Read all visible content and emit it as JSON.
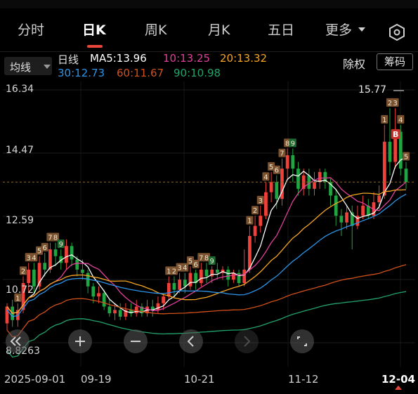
{
  "tabs": [
    {
      "label": "分时"
    },
    {
      "label": "日K"
    },
    {
      "label": "周K"
    },
    {
      "label": "月K"
    },
    {
      "label": "五日"
    },
    {
      "label": "更多"
    }
  ],
  "ma_select": {
    "label": "均线"
  },
  "ma_line1": {
    "period": "日线",
    "ma5": "MA5:13.96",
    "ma10": "10:13.25",
    "ma20": "20:13.32"
  },
  "ma_line2": {
    "ma30": "30:12.73",
    "ma60": "60:11.67",
    "ma90": "90:10.98"
  },
  "buttons": {
    "fuquan": "除权",
    "chouma": "筹码"
  },
  "y_axis": {
    "labels": [
      "16.34",
      "14.47",
      "12.59",
      "10.72",
      "8.8263"
    ]
  },
  "x_axis": {
    "labels": [
      "2025-09-01",
      "09-19",
      "10-21",
      "11-12",
      "12-04"
    ]
  },
  "annotations": {
    "high_label": "15.77",
    "b_marker": "B"
  },
  "colors": {
    "up": "#f0403a",
    "down": "#1fa542",
    "ma5": "#ffffff",
    "ma10": "#e0409a",
    "ma20": "#f5a623",
    "ma30": "#2b95e9",
    "ma60": "#d0501a",
    "ma90": "#22a36b"
  },
  "zoom_controls": {
    "icons": [
      "collapse-icon",
      "plus-icon",
      "minus-icon",
      "left-arrow-icon",
      "right-arrow-icon",
      "fullscreen-icon"
    ]
  },
  "chart_data": {
    "type": "candlestick",
    "ylim": [
      8.8263,
      16.34
    ],
    "x_ticks": [
      "2025-09-01",
      "09-19",
      "10-21",
      "11-12",
      "12-04"
    ],
    "candles": [
      [
        9.4,
        9.9,
        9.2,
        10.0
      ],
      [
        9.9,
        9.5,
        9.3,
        10.1
      ],
      [
        9.5,
        9.8,
        9.3,
        10.0
      ],
      [
        9.8,
        10.6,
        9.7,
        10.8
      ],
      [
        10.6,
        11.0,
        10.3,
        11.2
      ],
      [
        11.0,
        10.5,
        10.3,
        11.2
      ],
      [
        10.5,
        11.2,
        10.4,
        11.4
      ],
      [
        11.2,
        11.0,
        10.8,
        11.5
      ],
      [
        11.0,
        11.6,
        10.9,
        11.8
      ],
      [
        11.6,
        11.4,
        11.1,
        11.8
      ],
      [
        11.4,
        11.2,
        11.0,
        11.6
      ],
      [
        11.2,
        11.7,
        11.0,
        11.9
      ],
      [
        11.7,
        11.3,
        11.1,
        11.8
      ],
      [
        11.3,
        11.0,
        10.8,
        11.4
      ],
      [
        11.0,
        10.9,
        10.7,
        11.3
      ],
      [
        10.9,
        10.5,
        10.3,
        11.0
      ],
      [
        10.5,
        10.2,
        10.0,
        10.6
      ],
      [
        10.2,
        10.3,
        10.0,
        10.5
      ],
      [
        10.3,
        9.9,
        9.8,
        10.4
      ],
      [
        9.9,
        9.7,
        9.6,
        10.1
      ],
      [
        9.7,
        9.8,
        9.5,
        10.0
      ],
      [
        9.8,
        9.6,
        9.5,
        10.0
      ],
      [
        9.6,
        9.8,
        9.5,
        10.0
      ],
      [
        9.8,
        9.7,
        9.6,
        10.0
      ],
      [
        9.7,
        9.9,
        9.6,
        10.1
      ],
      [
        9.9,
        9.7,
        9.6,
        10.0
      ],
      [
        9.7,
        9.9,
        9.6,
        10.1
      ],
      [
        9.9,
        9.8,
        9.6,
        10.1
      ],
      [
        9.8,
        10.0,
        9.7,
        10.2
      ],
      [
        10.0,
        10.2,
        9.8,
        10.3
      ],
      [
        10.2,
        10.6,
        10.1,
        10.8
      ],
      [
        10.6,
        10.4,
        10.2,
        10.8
      ],
      [
        10.4,
        10.7,
        10.3,
        10.9
      ],
      [
        10.7,
        10.5,
        10.3,
        10.9
      ],
      [
        10.5,
        10.9,
        10.4,
        11.1
      ],
      [
        10.9,
        10.6,
        10.4,
        11.0
      ],
      [
        10.6,
        11.0,
        10.5,
        11.2
      ],
      [
        11.0,
        10.8,
        10.6,
        11.2
      ],
      [
        10.8,
        11.0,
        10.6,
        11.1
      ],
      [
        11.0,
        10.9,
        10.7,
        11.2
      ],
      [
        10.9,
        11.0,
        10.7,
        11.1
      ],
      [
        11.0,
        10.7,
        10.5,
        11.1
      ],
      [
        10.7,
        10.9,
        10.6,
        11.0
      ],
      [
        10.9,
        10.6,
        10.5,
        11.0
      ],
      [
        10.6,
        11.0,
        10.5,
        11.6
      ],
      [
        11.0,
        12.0,
        10.9,
        12.3
      ],
      [
        12.0,
        12.3,
        11.8,
        12.6
      ],
      [
        12.3,
        12.6,
        12.1,
        12.9
      ],
      [
        12.6,
        13.3,
        12.5,
        13.6
      ],
      [
        13.3,
        13.6,
        13.0,
        13.9
      ],
      [
        13.6,
        13.1,
        12.8,
        13.8
      ],
      [
        13.1,
        14.0,
        12.9,
        14.3
      ],
      [
        14.0,
        14.4,
        13.7,
        14.6
      ],
      [
        14.4,
        14.0,
        13.6,
        14.6
      ],
      [
        14.0,
        13.4,
        13.2,
        14.2
      ],
      [
        13.4,
        13.8,
        13.2,
        14.0
      ],
      [
        13.8,
        13.4,
        13.2,
        14.0
      ],
      [
        13.4,
        13.6,
        13.2,
        13.9
      ],
      [
        13.6,
        13.9,
        13.4,
        14.0
      ],
      [
        13.9,
        13.6,
        13.4,
        14.0
      ],
      [
        13.6,
        13.2,
        12.9,
        13.7
      ],
      [
        13.2,
        12.6,
        12.3,
        13.4
      ],
      [
        12.6,
        12.4,
        12.0,
        12.8
      ],
      [
        12.4,
        12.7,
        12.2,
        12.9
      ],
      [
        12.7,
        12.3,
        11.6,
        12.9
      ],
      [
        12.3,
        12.6,
        12.2,
        12.9
      ],
      [
        12.6,
        12.9,
        12.5,
        13.2
      ],
      [
        12.9,
        12.6,
        12.5,
        13.1
      ],
      [
        12.6,
        13.0,
        12.5,
        13.3
      ],
      [
        13.0,
        13.2,
        12.8,
        13.5
      ],
      [
        13.2,
        14.8,
        13.1,
        15.3
      ],
      [
        14.8,
        14.2,
        13.8,
        15.8
      ],
      [
        14.2,
        15.1,
        14.0,
        15.8
      ],
      [
        15.1,
        14.0,
        13.8,
        15.3
      ],
      [
        14.0,
        13.6,
        13.4,
        14.2
      ]
    ]
  }
}
